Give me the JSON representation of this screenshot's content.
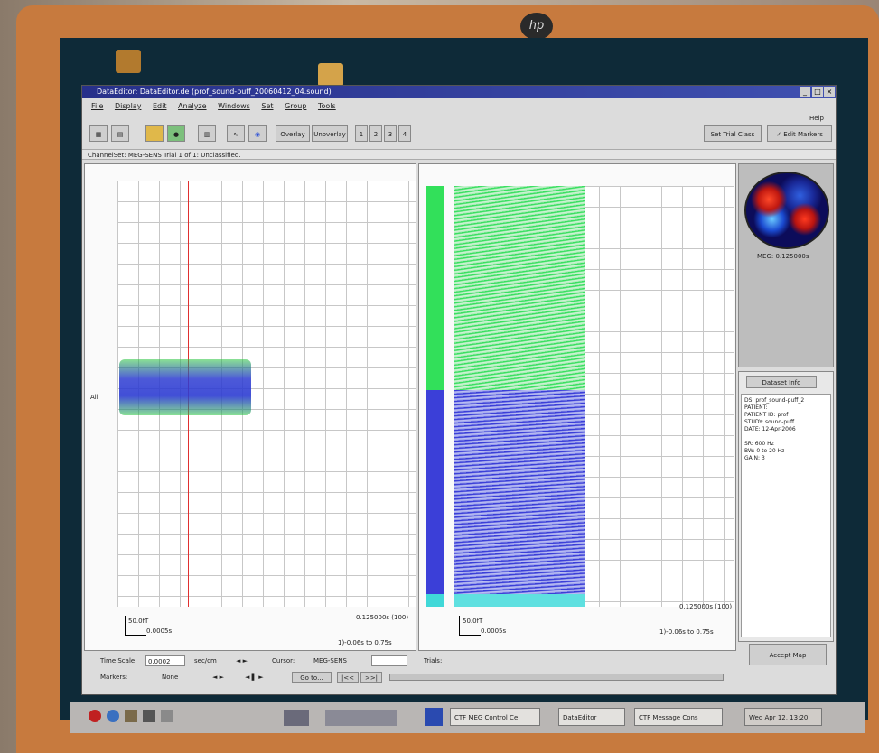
{
  "window": {
    "title": "DataEditor: DataEditor.de (prof_sound-puff_20060412_04.sound)",
    "help_label": "Help"
  },
  "menu": [
    "File",
    "Display",
    "Edit",
    "Analyze",
    "Windows",
    "Set",
    "Group",
    "Tools"
  ],
  "toolbar": {
    "overlay_label": "Overlay",
    "unoverlay_label": "Unoverlay",
    "pages": [
      "1",
      "2",
      "3",
      "4"
    ],
    "set_trial_class_label": "Set Trial Class",
    "edit_markers_label": "✓ Edit Markers"
  },
  "status_text": "ChannelSet: MEG-SENS   Trial 1 of 1: Unclassified.",
  "left_plot": {
    "channel_label": "All",
    "scale_label": "50.0fT",
    "time_scale_label": "0.0005s",
    "time_label": "0.125000s (100)",
    "range_label": "1)-0.06s to 0.75s"
  },
  "right_plot": {
    "scale_label": "50.0fT",
    "time_scale_label": "0.0005s",
    "time_label": "0.125000s (100)",
    "range_label": "1)-0.06s to 0.75s"
  },
  "topomap_label": "MEG: 0.125000s",
  "dataset_info": {
    "button_label": "Dataset Info",
    "lines": [
      "DS: prof_sound-puff_2",
      "PATIENT:",
      "PATIENT ID: prof",
      "STUDY: sound-puff",
      "DATE: 12-Apr-2006",
      "",
      "SR: 600 Hz",
      "BW: 0 to 20 Hz",
      "GAIN: 3"
    ]
  },
  "accept_map_label": "Accept Map",
  "bottom": {
    "time_scale_label": "Time Scale:",
    "time_scale_value": "0.0002",
    "time_scale_unit": "sec/cm",
    "cursor_label": "Cursor:",
    "cursor_value": "MEG-SENS",
    "trials_label": "Trials:",
    "markers_label": "Markers:",
    "markers_value": "None",
    "goto_label": "Go to..."
  },
  "taskbar": {
    "tasks": [
      "CTF MEG Control Ce",
      "DataEditor",
      "CTF Message Cons"
    ],
    "clock": "Wed Apr 12, 13:20"
  }
}
